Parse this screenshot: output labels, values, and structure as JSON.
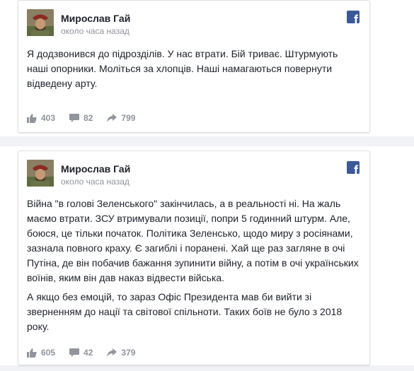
{
  "posts": [
    {
      "author": "Мирослав Гай",
      "time": "около часа назад",
      "paragraphs": [
        "Я додзвонився до підрозділів. У нас втрати. Бій триває. Штурмують наші опорники. Моліться за хлопців. Наші намагаються повернути відведену арту."
      ],
      "likes": "403",
      "comments": "82",
      "shares": "799"
    },
    {
      "author": "Мирослав Гай",
      "time": "около часа назад",
      "paragraphs": [
        "Війна \"в голові Зеленського\" закінчилась, а в реальності ні. На жаль маємо втрати. ЗСУ втримували позиції, попри 5 годинний штурм. Але, боюся, це тільки початок. Політика Зеленсько, щодо миру з росіянами, зазнала повного краху. Є загиблі і поранені. Хай ще раз загляне в очі Путіна, де він побачив бажання зупинити війну, а потім в очі українських воїнів, яким він дав наказ відвести війська.",
        "А якщо без емоцій, то зараз Офіс Президента мав би вийти зі зверненням до нації та світової спільноти. Таких боїв не було з 2018 року."
      ],
      "likes": "605",
      "comments": "42",
      "shares": "379"
    }
  ],
  "icons": {
    "brand": "facebook-icon",
    "like": "thumbs-up-icon",
    "comment": "comment-icon",
    "share": "share-arrow-icon"
  },
  "colors": {
    "facebook_blue": "#3b5998",
    "meta_text": "#90949c",
    "body_text": "#1d2129"
  }
}
